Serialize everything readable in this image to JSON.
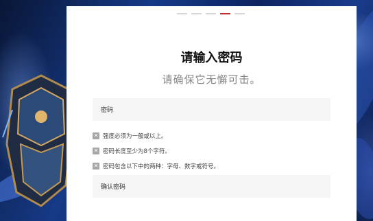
{
  "steps": {
    "total": 5,
    "active_index": 3
  },
  "header": {
    "title": "请输入密码",
    "subtitle": "请确保它无懈可击。"
  },
  "form": {
    "password_placeholder": "密码",
    "confirm_placeholder": "确认密码"
  },
  "rules": [
    {
      "icon": "x-icon",
      "text": "强度必须为一般或以上。"
    },
    {
      "icon": "x-icon",
      "text": "密码长度至少为8个字符。"
    },
    {
      "icon": "x-icon",
      "text": "密码包含以下中的两种：字母、数字或符号。"
    }
  ],
  "colors": {
    "accent": "#c8292f",
    "step_inactive": "#d6d6d6",
    "field_bg": "#f5f5f5",
    "rule_icon": "#a6a6a6"
  }
}
